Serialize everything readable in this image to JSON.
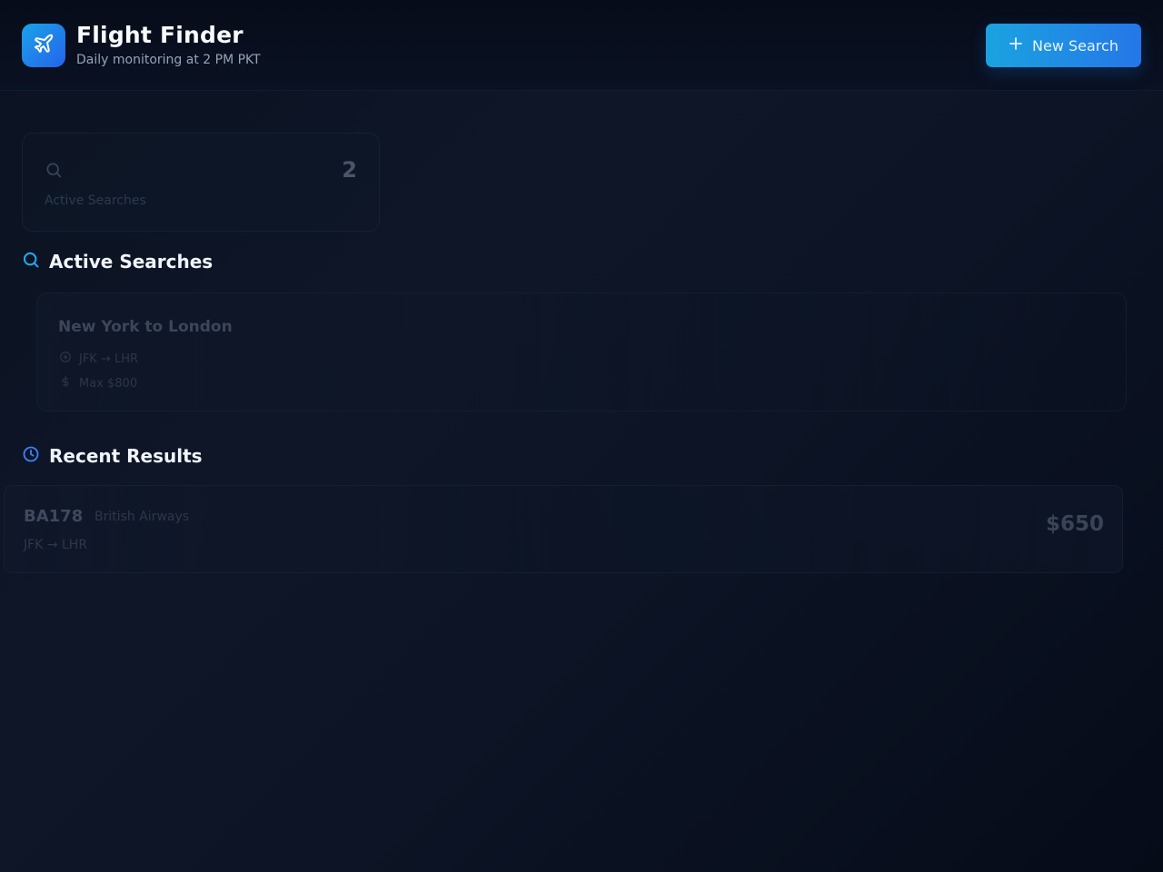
{
  "header": {
    "title": "Flight Finder",
    "subtitle": "Daily monitoring at 2 PM PKT",
    "logo_icon": "plane-icon",
    "new_search_label": "New Search",
    "new_search_icon": "plus-icon"
  },
  "stats": {
    "active_searches_count": "2",
    "active_searches_label": "Active Searches",
    "icon": "search-icon"
  },
  "active_searches": {
    "title": "Active Searches",
    "icon": "search-icon",
    "items": [
      {
        "name": "New York to London",
        "route": "JFK → LHR",
        "route_icon": "plane-icon",
        "max_price": "Max $800",
        "price_icon": "dollar-icon"
      }
    ]
  },
  "recent_results": {
    "title": "Recent Results",
    "icon": "clock-icon",
    "items": [
      {
        "flight_number": "BA178",
        "airline": "British Airways",
        "route": "JFK → LHR",
        "price": "$650"
      }
    ]
  },
  "colors": {
    "accent": "#1aa3e8",
    "accent_secondary": "#2563eb",
    "background": "#0e1628"
  }
}
